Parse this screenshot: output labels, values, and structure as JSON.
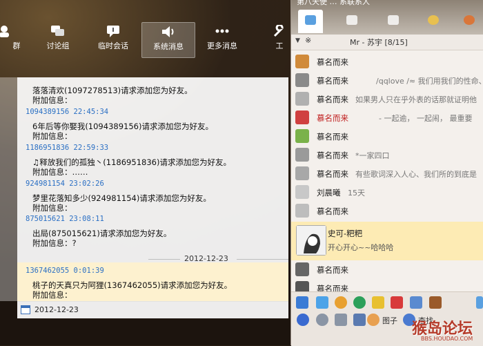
{
  "left": {
    "toolbar": [
      {
        "label": "群",
        "icon": "group-icon"
      },
      {
        "label": "讨论组",
        "icon": "discussion-icon"
      },
      {
        "label": "临时会话",
        "icon": "temp-chat-icon"
      },
      {
        "label": "系统消息",
        "icon": "speaker-icon",
        "active": true
      },
      {
        "label": "更多消息",
        "icon": "more-icon"
      },
      {
        "label": "工",
        "icon": "tool-icon"
      }
    ],
    "messages": [
      {
        "meta": "",
        "text": "落落清欢(1097278513)请求添加您为好友。",
        "extra": "附加信息："
      },
      {
        "meta": "1094389156 22:45:34",
        "text": "6年后等你娶我(1094389156)请求添加您为好友。",
        "extra": "附加信息："
      },
      {
        "meta": "1186951836 22:59:33",
        "text": "♫释放我们的孤独丶(1186951836)请求添加您为好友。",
        "extra": "附加信息：……"
      },
      {
        "meta": "924981154 23:02:26",
        "text": "梦里花落知多少(924981154)请求添加您为好友。",
        "extra": "附加信息："
      },
      {
        "meta": "875015621 23:08:11",
        "text": "出局(875015621)请求添加您为好友。",
        "extra": "附加信息：?"
      },
      {
        "meta": "1367462055 0:01:39",
        "text": "桃子的天真只为阿狸(1367462055)请求添加您为好友。",
        "extra": "附加信息："
      }
    ],
    "separator_date": "2012-12-23",
    "footer_date": "2012-12-23"
  },
  "right": {
    "title": "第八天使 … 系联系人",
    "group_header": {
      "arrow": "▼",
      "star": "※",
      "label": "Mr - 苏宇  [8/15]"
    },
    "contacts": [
      {
        "name": "慕名而来",
        "sign": ""
      },
      {
        "name": "慕名而来",
        "sign": "/qqlove /≈ 我们用我们的性命、"
      },
      {
        "name": "慕名而来",
        "sign": "如果男人只在乎外表的话那就证明他"
      },
      {
        "name": "慕名而来",
        "sign": "- 一起逾，   一起闹，      最重要",
        "red": true
      },
      {
        "name": "慕名而来",
        "sign": ""
      },
      {
        "name": "慕名而来",
        "sign": "*一家四口"
      },
      {
        "name": "慕名而来",
        "sign": "有些歌词深入人心、我们所的到底是"
      },
      {
        "name": "刘晨曦",
        "sign": "15天"
      },
      {
        "name": "慕名而来",
        "sign": ""
      },
      {
        "name": "史可-粑粑",
        "sign": "开心开心~~哈哈哈",
        "selected": true
      },
      {
        "name": "慕名而来",
        "sign": ""
      },
      {
        "name": "慕名而来",
        "sign": ""
      }
    ],
    "bottom": {
      "label1": "图子",
      "label2": "查找"
    }
  },
  "watermark": {
    "text": "猴岛论坛",
    "url": "BBS.HOUDAO.COM"
  },
  "colors": {
    "accent": "#2a6fc4",
    "highlight": "#fdf1cf",
    "selected": "#fdebb4",
    "red_name": "#c02020"
  }
}
